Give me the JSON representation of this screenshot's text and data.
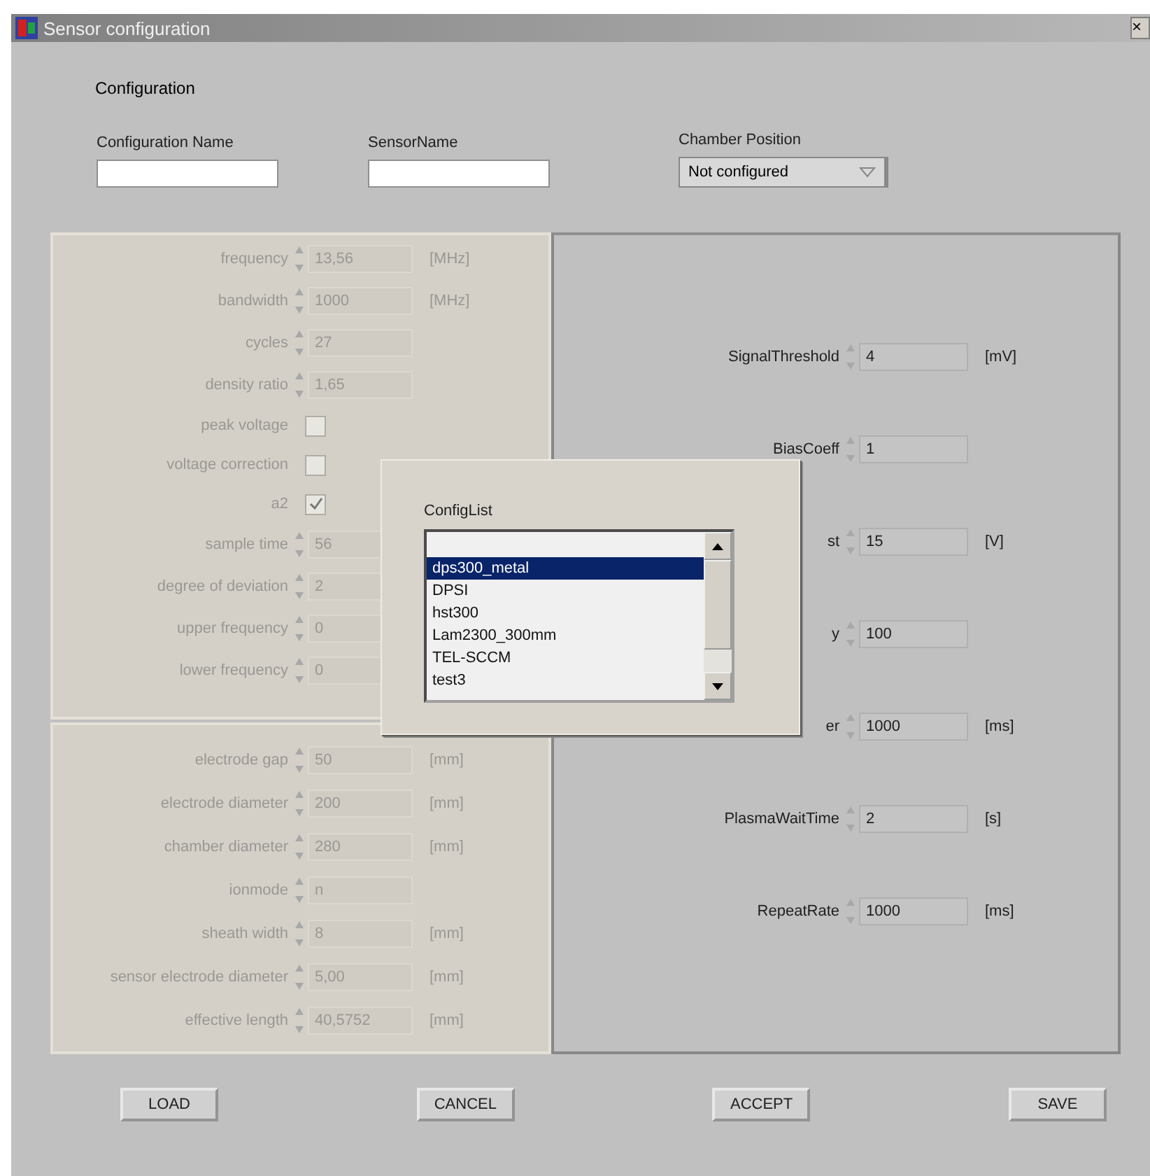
{
  "window": {
    "title": "Sensor configuration",
    "close": "×"
  },
  "configuration": {
    "heading": "Configuration",
    "fields": [
      {
        "label": "Configuration Name"
      },
      {
        "label": "SensorName"
      }
    ],
    "chamber_position": {
      "label": "Chamber Position",
      "value": "Not configured"
    }
  },
  "plasma_panel": {
    "disabled": true,
    "rows": [
      {
        "kind": "numeric",
        "label": "frequency",
        "value": "13,56",
        "unit": "[MHz]"
      },
      {
        "kind": "numeric",
        "label": "bandwidth",
        "value": "1000",
        "unit": "[MHz]"
      },
      {
        "kind": "numeric",
        "label": "cycles",
        "value": "27"
      },
      {
        "kind": "numeric",
        "label": "density ratio",
        "value": "1,65"
      },
      {
        "kind": "checkbox",
        "label": "peak voltage",
        "checked": false
      },
      {
        "kind": "checkbox",
        "label": "voltage correction",
        "checked": false
      },
      {
        "kind": "checkbox",
        "label": "a2",
        "checked": true
      },
      {
        "kind": "numeric",
        "label": "sample time",
        "value": "56"
      },
      {
        "kind": "numeric",
        "label": "degree of deviation",
        "value": "2"
      },
      {
        "kind": "numeric",
        "label": "upper frequency",
        "value": "0"
      },
      {
        "kind": "numeric",
        "label": "lower frequency",
        "value": "0"
      }
    ]
  },
  "geometry_panel": {
    "disabled": true,
    "rows": [
      {
        "kind": "numeric",
        "label": "electrode gap",
        "value": "50",
        "unit": "[mm]"
      },
      {
        "kind": "numeric",
        "label": "electrode diameter",
        "value": "200",
        "unit": "[mm]"
      },
      {
        "kind": "numeric",
        "label": "chamber diameter",
        "value": "280",
        "unit": "[mm]"
      },
      {
        "kind": "numeric",
        "label": "ionmode",
        "value": "n"
      },
      {
        "kind": "numeric",
        "label": "sheath width",
        "value": "8",
        "unit": "[mm]"
      },
      {
        "kind": "numeric",
        "label": "sensor electrode diameter",
        "value": "5,00",
        "unit": "[mm]"
      },
      {
        "kind": "numeric",
        "label": "effective length",
        "value": "40,5752",
        "unit": "[mm]"
      }
    ]
  },
  "measurement_panel": {
    "disabled": false,
    "rows": [
      {
        "label": "SignalThreshold",
        "value": "4",
        "unit": "[mV]"
      },
      {
        "label": "BiasCoeff",
        "value": "1"
      },
      {
        "label": "st",
        "value": "15",
        "unit": "[V]"
      },
      {
        "label": "y",
        "value": "100"
      },
      {
        "label": "er",
        "value": "1000",
        "unit": "[ms]"
      },
      {
        "label": "PlasmaWaitTime",
        "value": "2",
        "unit": "[s]"
      },
      {
        "label": "RepeatRate",
        "value": "1000",
        "unit": "[ms]"
      }
    ]
  },
  "config_list": {
    "label": "ConfigList",
    "items": [
      {
        "text": "dps300_metal",
        "selected": true
      },
      {
        "text": "DPSI",
        "selected": false
      },
      {
        "text": "hst300",
        "selected": false
      },
      {
        "text": "Lam2300_300mm",
        "selected": false
      },
      {
        "text": "TEL-SCCM",
        "selected": false
      },
      {
        "text": "test3",
        "selected": false
      }
    ]
  },
  "buttons": [
    "LOAD",
    "CANCEL",
    "ACCEPT",
    "SAVE"
  ]
}
